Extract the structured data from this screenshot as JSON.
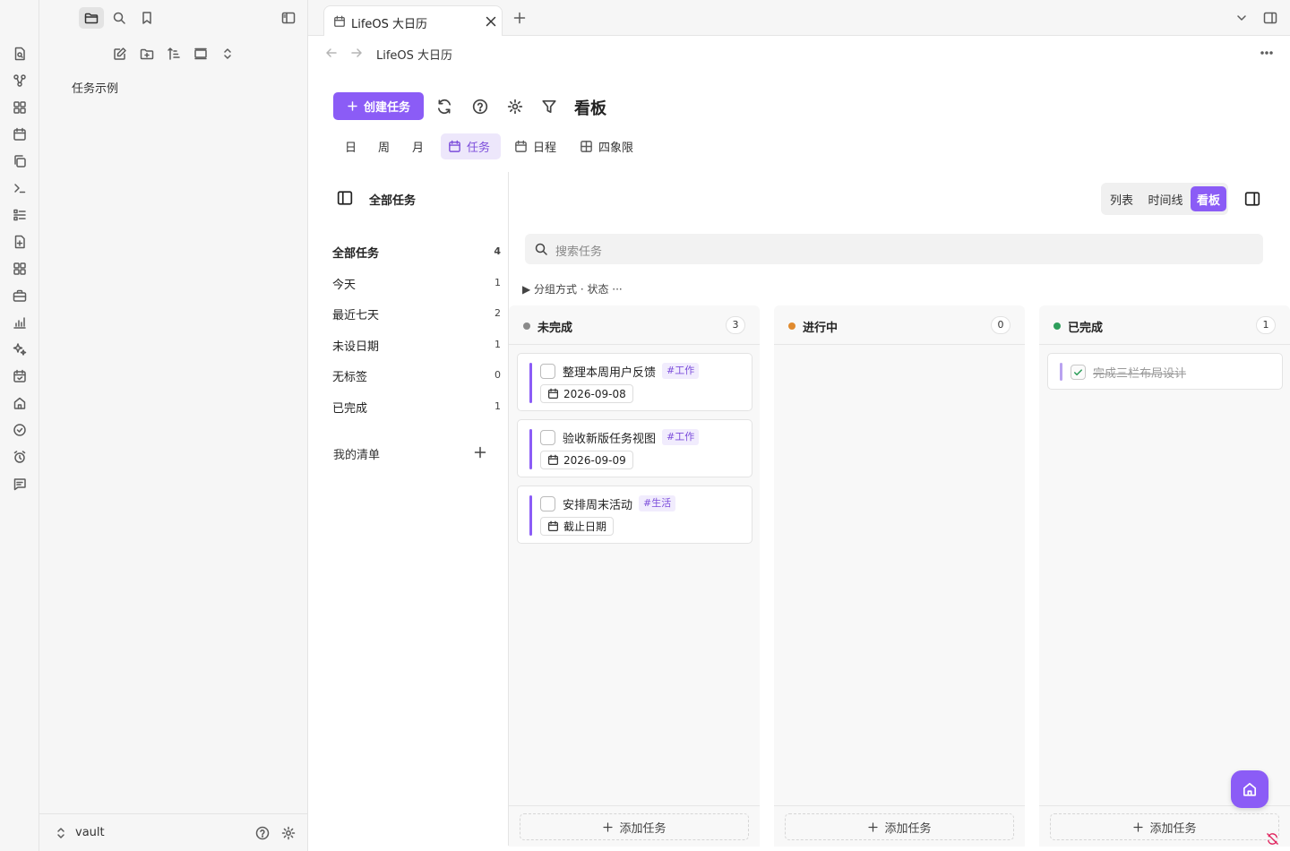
{
  "sidebar": {
    "file_item": "任务示例",
    "vault_name": "vault"
  },
  "tab": {
    "title": "LifeOS 大日历"
  },
  "header": {
    "breadcrumb": "LifeOS 大日历"
  },
  "toolbar": {
    "create_label": "创建任务",
    "view_title": "看板"
  },
  "view_tabs": [
    {
      "label": "日"
    },
    {
      "label": "周"
    },
    {
      "label": "月"
    },
    {
      "label": "任务"
    },
    {
      "label": "日程"
    },
    {
      "label": "四象限"
    }
  ],
  "task_sidebar": {
    "title": "全部任务",
    "filters": [
      {
        "label": "全部任务",
        "count": "4"
      },
      {
        "label": "今天",
        "count": "1"
      },
      {
        "label": "最近七天",
        "count": "2"
      },
      {
        "label": "未设日期",
        "count": "1"
      },
      {
        "label": "无标签",
        "count": "0"
      },
      {
        "label": "已完成",
        "count": "1"
      }
    ],
    "my_lists": "我的清单"
  },
  "main": {
    "modes": [
      {
        "label": "列表"
      },
      {
        "label": "时间线"
      },
      {
        "label": "看板"
      }
    ],
    "search_placeholder": "搜索任务",
    "group_by": "▶ 分组方式 · 状态 ···"
  },
  "board": {
    "add_label": "添加任务",
    "columns": [
      {
        "title": "未完成",
        "count": "3",
        "color": "#8a8a8a",
        "cards": [
          {
            "title": "整理本周用户反馈",
            "tag": "#工作",
            "date": "2026-09-08"
          },
          {
            "title": "验收新版任务视图",
            "tag": "#工作",
            "date": "2026-09-09"
          },
          {
            "title": "安排周末活动",
            "tag": "#生活",
            "date": "截止日期"
          }
        ]
      },
      {
        "title": "进行中",
        "count": "0",
        "color": "#e08a2e",
        "cards": []
      },
      {
        "title": "已完成",
        "count": "1",
        "color": "#2e9e5b",
        "cards": [
          {
            "title": "完成三栏布局设计"
          }
        ]
      }
    ]
  },
  "colors": {
    "accent": "#8b5cf6",
    "accent_soft": "#ede7fb"
  }
}
